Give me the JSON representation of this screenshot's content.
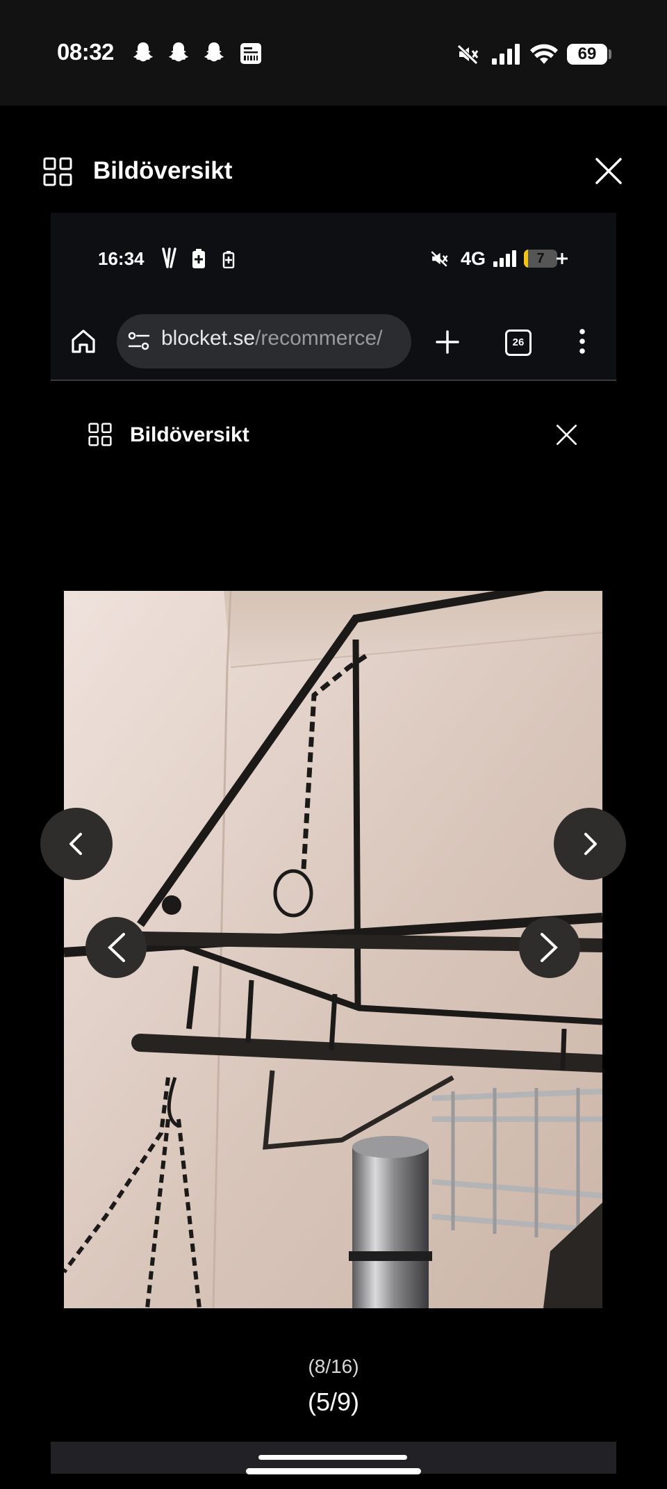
{
  "status_bar": {
    "time": "08:32",
    "notification_icons": [
      "snapchat-icon",
      "snapchat-icon",
      "snapchat-icon",
      "news-icon"
    ],
    "battery": "69"
  },
  "viewer": {
    "title": "Bildöversikt",
    "counter": "(5/9)"
  },
  "inner_screenshot": {
    "status_bar": {
      "time": "16:34",
      "network": "4G",
      "battery": "7"
    },
    "browser": {
      "url_domain": "blocket.se",
      "url_path": "/recommerce/",
      "tab_count": "26"
    },
    "viewer": {
      "title": "Bildöversikt",
      "counter": "(8/16)"
    }
  },
  "colors": {
    "background": "#000000",
    "status_bar": "#121212",
    "url_bar": "#2b2c30",
    "nav_button": "#2f2d2b"
  }
}
